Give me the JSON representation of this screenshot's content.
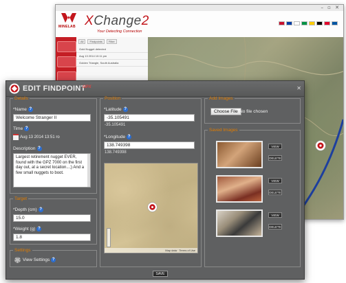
{
  "back_window": {
    "app_title_prefix": "X",
    "app_title_mid": "Change",
    "app_title_suffix": "2",
    "tagline": "Your Detecting Connection",
    "logo_text": "MINELAB",
    "window_controls": "– ▫ ✕",
    "list_tabs": [
      "All",
      "Findpoints",
      "Filter"
    ],
    "list_rows": [
      "Gold Nugget detected",
      "Aug 13 2014 10:11 pm",
      "Golden Triangle, South Australia"
    ],
    "flag_colors": [
      "#c8102e",
      "#003da5",
      "#ffffff",
      "#009246",
      "#ffcc00",
      "#000000",
      "#e4002b",
      "#0055a4"
    ]
  },
  "dialog": {
    "title": "EDIT FINDPOINT",
    "small_logo": "GPX",
    "details": {
      "legend": "Details",
      "name_label": "Name",
      "name_value": "Welcome Stranger II",
      "time_label": "Time",
      "time_value": "Aug 13 2014 13:51 ro",
      "description_label": "Description",
      "description_value": "Largest retirement nugget EVER, found with the GPZ 7000 on the first day out, at a secret location...;) And a few small nuggets to boot."
    },
    "target": {
      "legend": "Target",
      "depth_label": "Depth (cm)",
      "depth_value": "15.0",
      "weight_label": "Weight (g)",
      "weight_value": "1.8"
    },
    "settings": {
      "legend": "Settings",
      "view_label": "View Settings"
    },
    "position": {
      "legend": "Position",
      "latitude_label": "Latitude",
      "latitude_value": "-35.105491",
      "latitude_text": "-35.105491",
      "longitude_label": "Longitude",
      "longitude_value": "138.749398",
      "longitude_text": "138.749398",
      "map_footer": "Map data · Terms of Use"
    },
    "add_images": {
      "legend": "Add Images",
      "choose_file": "Choose File",
      "file_status": "No file chosen"
    },
    "saved_images": {
      "legend": "Saved Images",
      "view_label": "VIEW",
      "delete_label": "DELETE"
    },
    "save_label": "SAVE"
  }
}
